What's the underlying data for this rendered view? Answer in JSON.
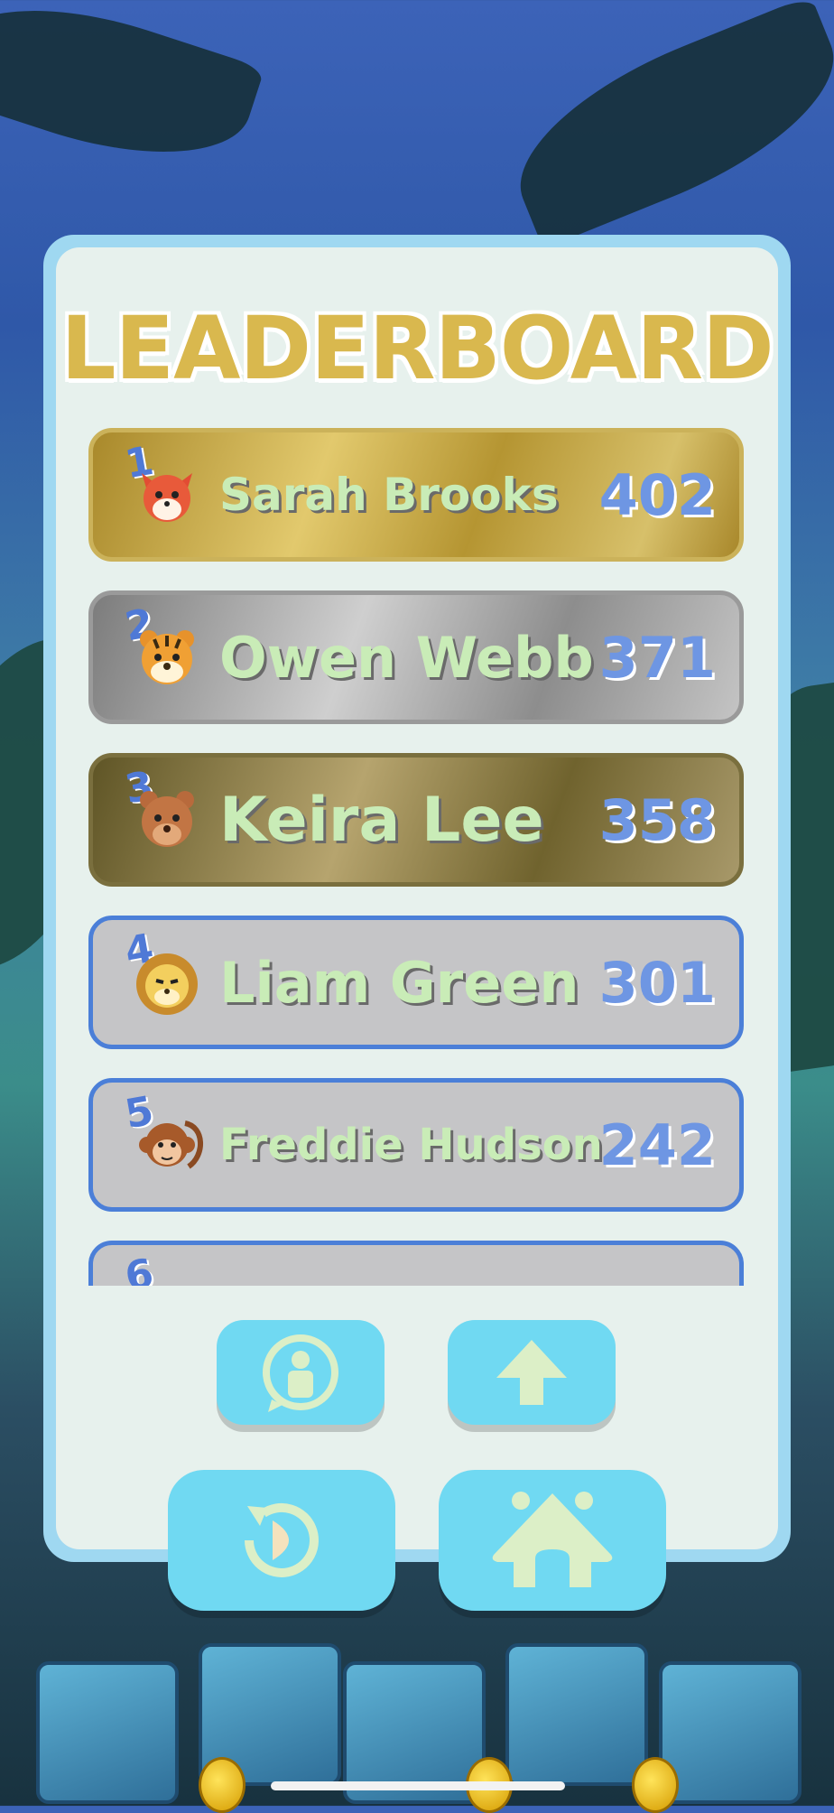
{
  "title": "LEADERBOARD",
  "colors": {
    "title_gold": "#d9b84e",
    "title_blue": "#5dd0f0",
    "name_green": "#c9ecb7",
    "score_blue": "#6e96e3",
    "button_cyan": "#70d9f2",
    "icon_cream": "#dcefc7"
  },
  "players": [
    {
      "rank": "1",
      "name": "Sarah Brooks",
      "score": "402",
      "tier": "gold",
      "avatar": "fox-avatar-icon"
    },
    {
      "rank": "2",
      "name": "Owen Webb",
      "score": "371",
      "tier": "silver",
      "avatar": "tiger-avatar-icon"
    },
    {
      "rank": "3",
      "name": "Keira Lee",
      "score": "358",
      "tier": "bronze",
      "avatar": "bear-avatar-icon"
    },
    {
      "rank": "4",
      "name": "Liam Green",
      "score": "301",
      "tier": "plain",
      "avatar": "lion-avatar-icon"
    },
    {
      "rank": "5",
      "name": "Freddie Hudson",
      "score": "242",
      "tier": "plain",
      "avatar": "monkey-avatar-icon"
    },
    {
      "rank": "6",
      "name": "",
      "score": "",
      "tier": "plain",
      "avatar": ""
    }
  ],
  "buttons": {
    "profile": "person-chat-icon",
    "upload": "up-arrow-icon",
    "replay": "replay-icon",
    "home": "house-icon"
  }
}
